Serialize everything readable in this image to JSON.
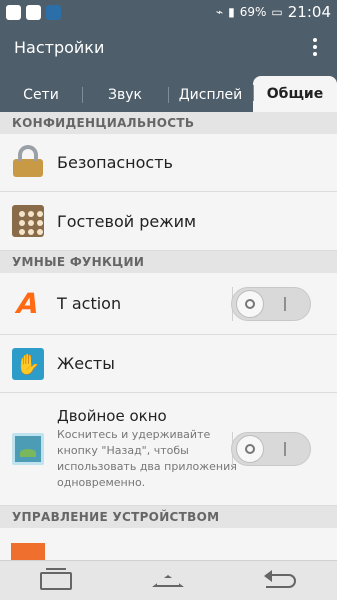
{
  "status": {
    "battery": "69%",
    "time": "21:04"
  },
  "header": {
    "title": "Настройки"
  },
  "tabs": [
    {
      "label": "Сети"
    },
    {
      "label": "Звук"
    },
    {
      "label": "Дисплей"
    },
    {
      "label": "Общие"
    }
  ],
  "sections": {
    "privacy": "КОНФИДЕНЦИАЛЬНОСТЬ",
    "smart": "УМНЫЕ ФУНКЦИИ",
    "device": "УПРАВЛЕНИЕ УСТРОЙСТВОМ"
  },
  "items": {
    "security": "Безопасность",
    "guest": "Гостевой режим",
    "taction": "T action",
    "gestures": "Жесты",
    "dual_title": "Двойное окно",
    "dual_desc": "Коснитесь и удерживайте кнопку \"Назад\", чтобы использовать два приложения одновременно."
  },
  "icons": {
    "security": "lock-icon",
    "guest": "guest-mode-icon",
    "taction": "t-action-icon",
    "gestures": "hand-icon",
    "dual_window": "dual-window-icon",
    "device": "device-icon"
  },
  "colors": {
    "app_bar": "#4e5e6a",
    "accent_orange": "#ff6a13",
    "gesture_blue": "#2e9cc8"
  }
}
